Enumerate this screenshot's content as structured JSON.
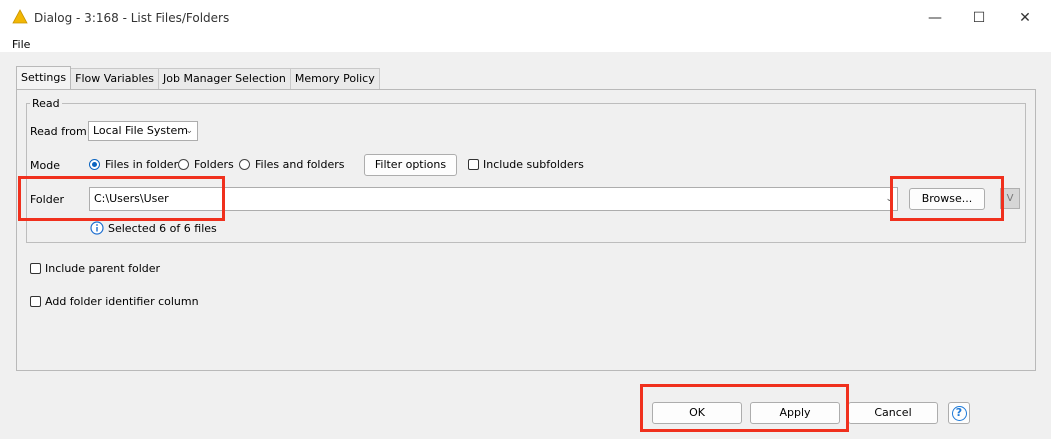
{
  "window": {
    "title": "Dialog - 3:168 - List Files/Folders",
    "minimize_glyph": "—",
    "maximize_glyph": "☐",
    "close_glyph": "✕"
  },
  "menu": {
    "file": "File"
  },
  "tabs": [
    {
      "label": "Settings",
      "active": true
    },
    {
      "label": "Flow Variables"
    },
    {
      "label": "Job Manager Selection"
    },
    {
      "label": "Memory Policy"
    }
  ],
  "read_group": {
    "title": "Read",
    "read_from_label": "Read from",
    "read_from_value": "Local File System",
    "mode_label": "Mode",
    "modes": [
      "Files in folder",
      "Folders",
      "Files and folders"
    ],
    "selected_mode": "Files in folder",
    "filter_options_label": "Filter options",
    "include_subfolders_label": "Include subfolders",
    "folder_label": "Folder",
    "folder_value": "C:\\Users\\User",
    "browse_label": "Browse...",
    "info_text": "Selected 6 of 6 files"
  },
  "options": {
    "include_parent_folder": "Include parent folder",
    "add_folder_identifier": "Add folder identifier column"
  },
  "footer": {
    "ok": "OK",
    "apply": "Apply",
    "cancel": "Cancel",
    "help": "?"
  },
  "colors": {
    "highlight": "#f0301d",
    "accent": "#0a64c0"
  }
}
